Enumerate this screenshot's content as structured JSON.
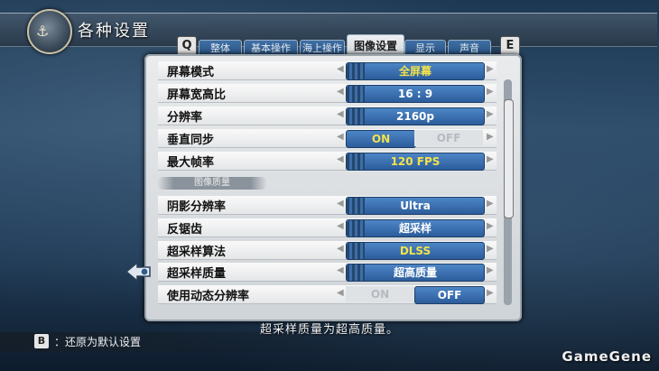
{
  "title": "各种设置",
  "title_emblem_glyph": "⚓",
  "keys": {
    "prev": "Q",
    "next": "E",
    "reset": "B"
  },
  "tabs": [
    {
      "label": "整体",
      "active": false
    },
    {
      "label": "基本操作",
      "active": false
    },
    {
      "label": "海上操作",
      "active": false
    },
    {
      "label": "图像设置",
      "active": true
    },
    {
      "label": "显示",
      "active": false
    },
    {
      "label": "声音",
      "active": false
    }
  ],
  "rows": [
    {
      "label": "屏幕模式",
      "value": "全屏幕",
      "yellow": true
    },
    {
      "label": "屏幕宽高比",
      "value": "16 : 9",
      "yellow": false
    },
    {
      "label": "分辨率",
      "value": "2160p",
      "yellow": false
    },
    {
      "label": "垂直同步",
      "on": "ON",
      "off": "OFF",
      "selected": "on"
    },
    {
      "label": "最大帧率",
      "value": "120 FPS",
      "yellow": true
    }
  ],
  "section": "图像质量",
  "rows2": [
    {
      "label": "阴影分辨率",
      "value": "Ultra",
      "yellow": false
    },
    {
      "label": "反锯齿",
      "value": "超采样",
      "yellow": false
    },
    {
      "label": "超采样算法",
      "value": "DLSS",
      "yellow": true
    },
    {
      "label": "超采样质量",
      "value": "超高质量",
      "yellow": false
    },
    {
      "label": "使用动态分辨率",
      "on": "ON",
      "off": "OFF",
      "selected": "off"
    }
  ],
  "description": "超采样质量为超高质量。",
  "footer_hint": "：还原为默认设置",
  "watermark": "GameGene",
  "colors": {
    "accent_blue": "#2c5c9b",
    "highlight_yellow": "#f2e24a"
  }
}
